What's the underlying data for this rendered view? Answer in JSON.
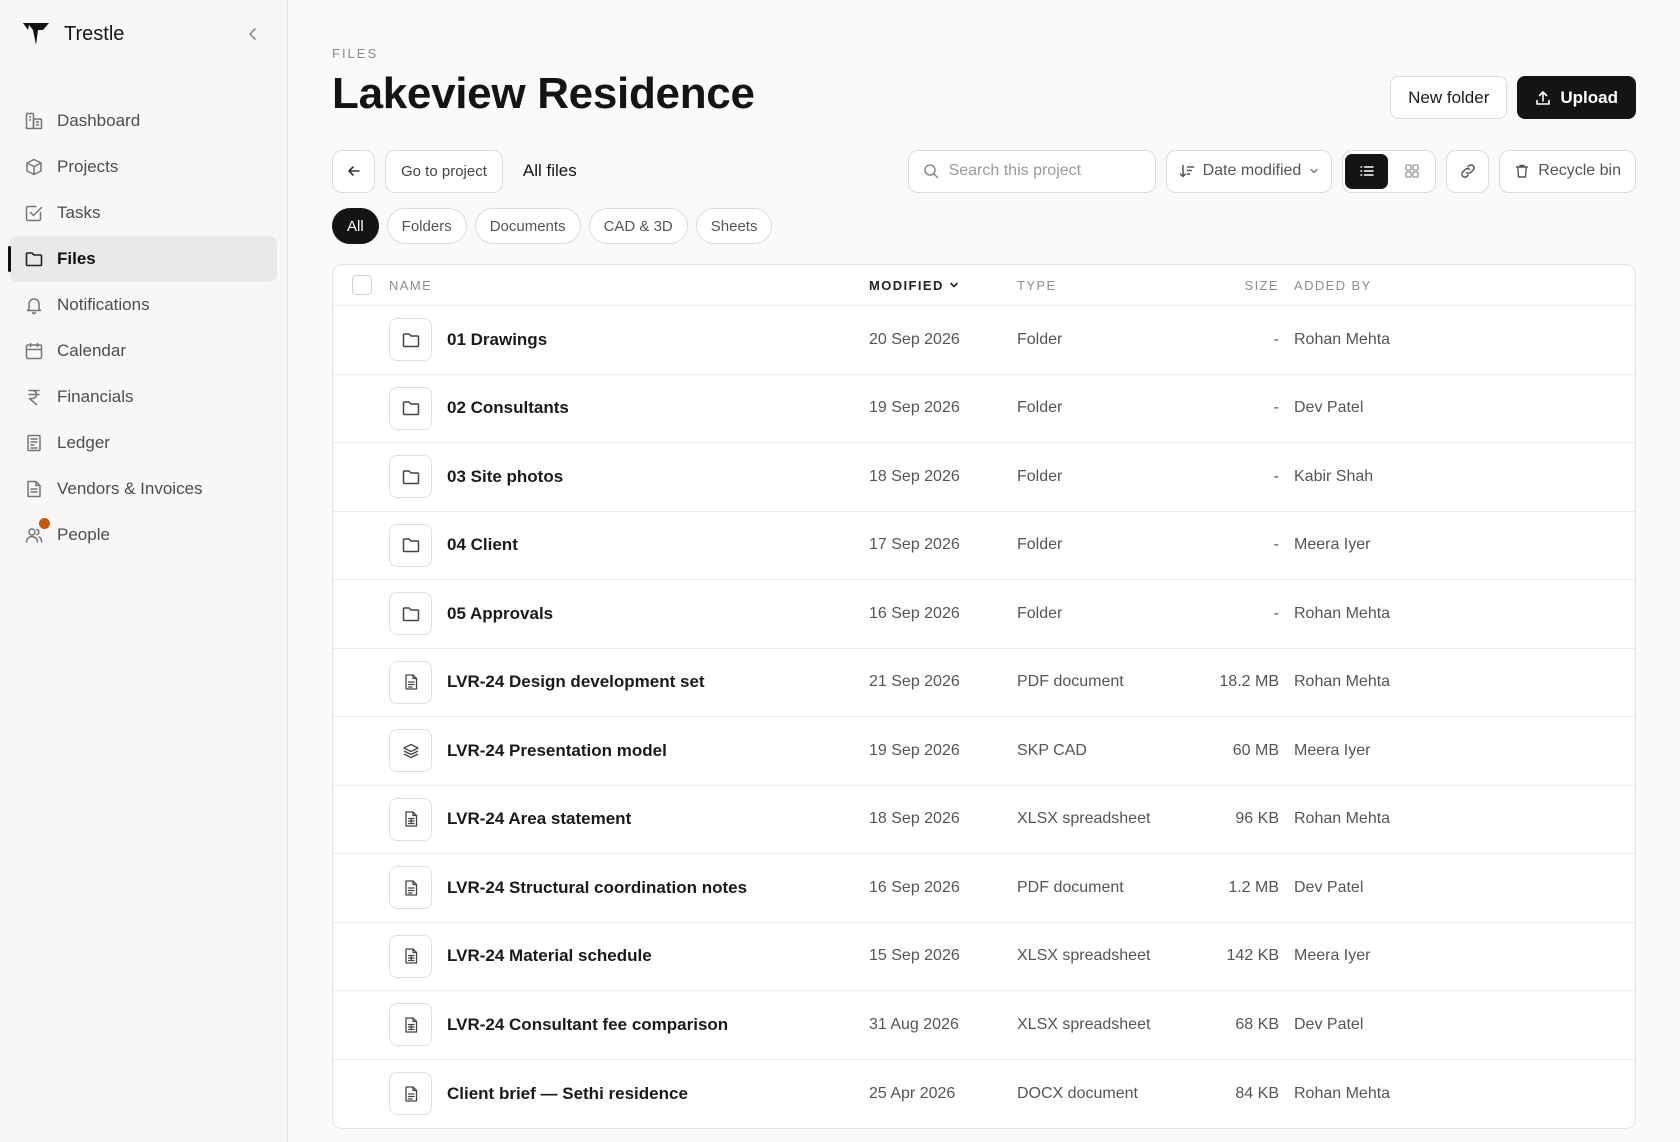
{
  "app": {
    "name": "Trestle"
  },
  "sidebar": {
    "items": [
      {
        "label": "Dashboard",
        "icon": "dashboard-icon"
      },
      {
        "label": "Projects",
        "icon": "box-icon"
      },
      {
        "label": "Tasks",
        "icon": "checkbox-icon"
      },
      {
        "label": "Files",
        "icon": "folder-icon",
        "active": true
      },
      {
        "label": "Notifications",
        "icon": "bell-icon"
      },
      {
        "label": "Calendar",
        "icon": "calendar-icon"
      },
      {
        "label": "Financials",
        "icon": "rupee-icon"
      },
      {
        "label": "Ledger",
        "icon": "ledger-icon"
      },
      {
        "label": "Vendors & Invoices",
        "icon": "invoice-icon"
      },
      {
        "label": "People",
        "icon": "people-icon",
        "badge_color": "#c35a10"
      }
    ]
  },
  "header": {
    "eyebrow": "FILES",
    "title": "Lakeview Residence",
    "new_folder_label": "New folder",
    "upload_label": "Upload"
  },
  "toolbar": {
    "go_to_project_label": "Go to project",
    "breadcrumb": "All files",
    "search_placeholder": "Search this project",
    "sort_label": "Date modified",
    "recycle_bin_label": "Recycle bin"
  },
  "filters": [
    "All",
    "Folders",
    "Documents",
    "CAD & 3D",
    "Sheets"
  ],
  "table": {
    "columns": {
      "name": "NAME",
      "modified": "MODIFIED",
      "type": "TYPE",
      "size": "SIZE",
      "added_by": "ADDED BY"
    },
    "rows": [
      {
        "icon": "folder",
        "name": "01 Drawings",
        "modified": "20 Sep 2026",
        "type": "Folder",
        "size": "-",
        "added_by": "Rohan Mehta"
      },
      {
        "icon": "folder",
        "name": "02 Consultants",
        "modified": "19 Sep 2026",
        "type": "Folder",
        "size": "-",
        "added_by": "Dev Patel"
      },
      {
        "icon": "folder",
        "name": "03 Site photos",
        "modified": "18 Sep 2026",
        "type": "Folder",
        "size": "-",
        "added_by": "Kabir Shah"
      },
      {
        "icon": "folder",
        "name": "04 Client",
        "modified": "17 Sep 2026",
        "type": "Folder",
        "size": "-",
        "added_by": "Meera Iyer"
      },
      {
        "icon": "folder",
        "name": "05 Approvals",
        "modified": "16 Sep 2026",
        "type": "Folder",
        "size": "-",
        "added_by": "Rohan Mehta"
      },
      {
        "icon": "document",
        "name": "LVR-24 Design development set",
        "modified": "21 Sep 2026",
        "type": "PDF document",
        "size": "18.2 MB",
        "added_by": "Rohan Mehta"
      },
      {
        "icon": "layers",
        "name": "LVR-24 Presentation model",
        "modified": "19 Sep 2026",
        "type": "SKP CAD",
        "size": "60 MB",
        "added_by": "Meera Iyer"
      },
      {
        "icon": "sheet",
        "name": "LVR-24 Area statement",
        "modified": "18 Sep 2026",
        "type": "XLSX spreadsheet",
        "size": "96 KB",
        "added_by": "Rohan Mehta"
      },
      {
        "icon": "document",
        "name": "LVR-24 Structural coordination notes",
        "modified": "16 Sep 2026",
        "type": "PDF document",
        "size": "1.2 MB",
        "added_by": "Dev Patel"
      },
      {
        "icon": "sheet",
        "name": "LVR-24 Material schedule",
        "modified": "15 Sep 2026",
        "type": "XLSX spreadsheet",
        "size": "142 KB",
        "added_by": "Meera Iyer"
      },
      {
        "icon": "sheet",
        "name": "LVR-24 Consultant fee comparison",
        "modified": "31 Aug 2026",
        "type": "XLSX spreadsheet",
        "size": "68 KB",
        "added_by": "Dev Patel"
      },
      {
        "icon": "document",
        "name": "Client brief — Sethi residence",
        "modified": "25 Apr 2026",
        "type": "DOCX document",
        "size": "84 KB",
        "added_by": "Rohan Mehta"
      }
    ]
  }
}
